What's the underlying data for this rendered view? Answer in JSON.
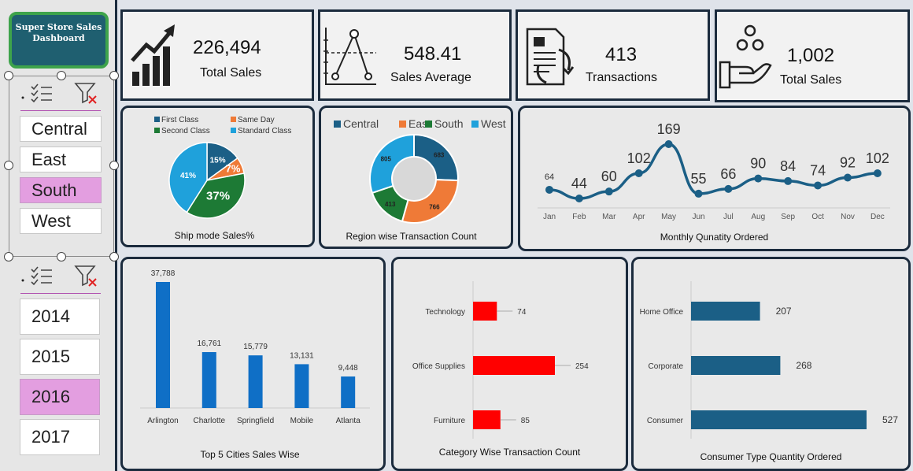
{
  "dashboard_title": "Super Store Sales Dashboard",
  "region_slicer": {
    "items": [
      "Central",
      "East",
      "South",
      "West"
    ],
    "selected": "South"
  },
  "year_slicer": {
    "items": [
      "2014",
      "2015",
      "2016",
      "2017"
    ],
    "selected": "2016"
  },
  "kpis": [
    {
      "value": "226,494",
      "label": "Total Sales",
      "icon": "growth-chart-icon"
    },
    {
      "value": "548.41",
      "label": "Sales Average",
      "icon": "line-graph-icon"
    },
    {
      "value": "413",
      "label": "Transactions",
      "icon": "document-exchange-icon"
    },
    {
      "value": "1,002",
      "label": "Total Sales",
      "icon": "hand-coins-icon"
    }
  ],
  "chart_data": [
    {
      "type": "pie",
      "title": "Ship mode Sales%",
      "legend": [
        "First Class",
        "Same Day",
        "Second Class",
        "Standard Class"
      ],
      "slices": [
        {
          "name": "First Class",
          "value": 15,
          "label": "15%",
          "color": "#1b5f86"
        },
        {
          "name": "Same Day",
          "value": 7,
          "label": "7%",
          "color": "#ef7a37"
        },
        {
          "name": "Second Class",
          "value": 37,
          "label": "37%",
          "color": "#1d7a35"
        },
        {
          "name": "Standard Class",
          "value": 41,
          "label": "41%",
          "color": "#1fa1db"
        }
      ]
    },
    {
      "type": "pie",
      "title": "Region wise Transaction Count",
      "legend": [
        "Central",
        "East",
        "South",
        "West"
      ],
      "slices": [
        {
          "name": "Central",
          "value": 683,
          "label": "683",
          "color": "#1b5f86"
        },
        {
          "name": "East",
          "value": 766,
          "label": "766",
          "color": "#ef7a37"
        },
        {
          "name": "South",
          "value": 413,
          "label": "413",
          "color": "#1d7a35"
        },
        {
          "name": "West",
          "value": 805,
          "label": "805",
          "color": "#1fa1db"
        }
      ]
    },
    {
      "type": "line",
      "title": "Monthly Qunatity Ordered",
      "categories": [
        "Jan",
        "Feb",
        "Mar",
        "Apr",
        "May",
        "Jun",
        "Jul",
        "Aug",
        "Sep",
        "Oct",
        "Nov",
        "Dec"
      ],
      "values": [
        64,
        44,
        60,
        102,
        169,
        55,
        66,
        90,
        84,
        74,
        92,
        102
      ],
      "color": "#1b5f86"
    },
    {
      "type": "bar",
      "title": "Top 5 Cities Sales Wise",
      "categories": [
        "Arlington",
        "Charlotte",
        "Springfield",
        "Mobile",
        "Atlanta"
      ],
      "values": [
        37788,
        16761,
        15779,
        13131,
        9448
      ],
      "value_labels": [
        "37,788",
        "16,761",
        "15,779",
        "13,131",
        "9,448"
      ],
      "color": "#0f6fc6"
    },
    {
      "type": "bar",
      "orientation": "horizontal",
      "title": "Category Wise Transaction Count",
      "categories": [
        "Technology",
        "Office Supplies",
        "Furniture"
      ],
      "values": [
        74,
        254,
        85
      ],
      "color": "#ff0000"
    },
    {
      "type": "bar",
      "orientation": "horizontal",
      "title": "Consumer Type Quantity Ordered",
      "categories": [
        "Home Office",
        "Corporate",
        "Consumer"
      ],
      "values": [
        207,
        268,
        527
      ],
      "color": "#1b5f86"
    }
  ]
}
